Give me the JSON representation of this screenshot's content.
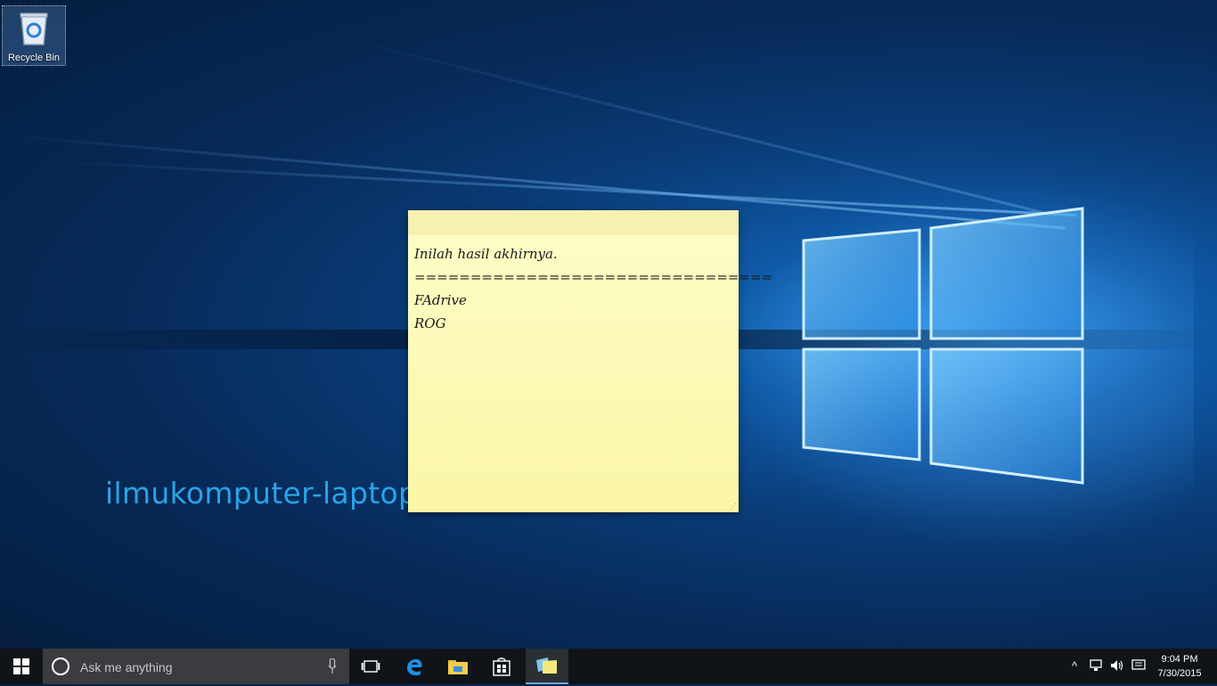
{
  "desktop": {
    "recycle_bin_label": "Recycle Bin",
    "watermark": "ilmukomputer-laptop.blogspot.com"
  },
  "sticky_note": {
    "lines": [
      "Inilah hasil akhirnya.",
      "================================",
      "FAdrive",
      "ROG"
    ]
  },
  "taskbar": {
    "search_placeholder": "Ask me anything",
    "clock_time": "9:04 PM",
    "clock_date": "7/30/2015",
    "icons": [
      "windows-start-icon",
      "cortana-icon",
      "microphone-icon",
      "task-view-icon",
      "edge-icon",
      "file-explorer-icon",
      "store-icon",
      "sticky-notes-icon",
      "chevron-up-icon",
      "network-icon",
      "volume-icon",
      "action-center-icon"
    ]
  },
  "colors": {
    "accent": "#29a3e8",
    "note": "#fbf6a6",
    "taskbar": "#101418"
  }
}
